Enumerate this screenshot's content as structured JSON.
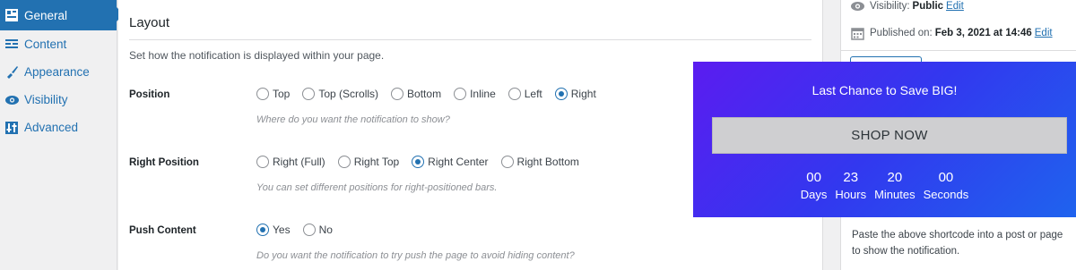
{
  "nav": {
    "items": [
      {
        "label": "General",
        "icon": "layout-grid-icon",
        "active": true
      },
      {
        "label": "Content",
        "icon": "text-lines-icon",
        "active": false
      },
      {
        "label": "Appearance",
        "icon": "paintbrush-icon",
        "active": false
      },
      {
        "label": "Visibility",
        "icon": "eye-icon",
        "active": false
      },
      {
        "label": "Advanced",
        "icon": "sliders-icon",
        "active": false
      }
    ]
  },
  "layout": {
    "title": "Layout",
    "description": "Set how the notification is displayed within your page.",
    "position": {
      "label": "Position",
      "options": [
        "Top",
        "Top (Scrolls)",
        "Bottom",
        "Inline",
        "Left",
        "Right"
      ],
      "selected": "Right",
      "help": "Where do you want the notification to show?"
    },
    "right_position": {
      "label": "Right Position",
      "options": [
        "Right (Full)",
        "Right Top",
        "Right Center",
        "Right Bottom"
      ],
      "selected": "Right Center",
      "help": "You can set different positions for right-positioned bars."
    },
    "push_content": {
      "label": "Push Content",
      "options": [
        "Yes",
        "No"
      ],
      "selected": "Yes",
      "help": "Do you want the notification to try push the page to avoid hiding content?"
    }
  },
  "meta": {
    "visibility_label": "Visibility:",
    "visibility_value": "Public",
    "visibility_edit": "Edit",
    "published_label": "Published on:",
    "published_value": "Feb 3, 2021 at 14:46",
    "published_edit": "Edit",
    "shortcode_note": "Paste the above shortcode into a post or page to show the notification."
  },
  "notification": {
    "title": "Last Chance to Save BIG!",
    "button_label": "SHOP NOW",
    "countdown": [
      {
        "value": "00",
        "unit": "Days"
      },
      {
        "value": "23",
        "unit": "Hours"
      },
      {
        "value": "20",
        "unit": "Minutes"
      },
      {
        "value": "00",
        "unit": "Seconds"
      }
    ],
    "colors": {
      "gradient_start": "#5b1cf0",
      "gradient_end": "#1f63ee",
      "button_bg": "#cfcfd1"
    }
  },
  "colors": {
    "accent": "#2271b1"
  }
}
